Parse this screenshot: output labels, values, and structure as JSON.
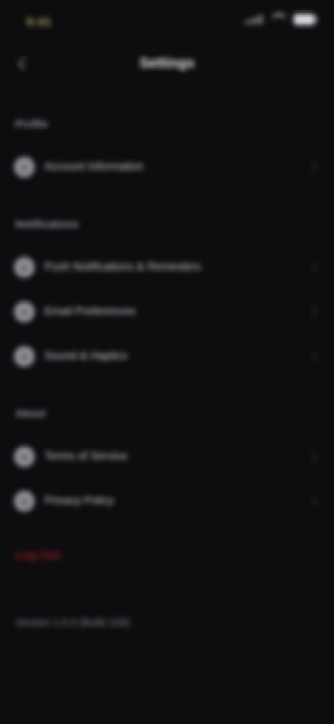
{
  "status": {
    "time": "9:41"
  },
  "header": {
    "title": "Settings"
  },
  "sections": [
    {
      "label": "Profile",
      "items": [
        {
          "label": "Account Information",
          "icon": "user-icon"
        }
      ]
    },
    {
      "label": "Notifications",
      "items": [
        {
          "label": "Push Notifications & Reminders",
          "icon": "bell-icon"
        },
        {
          "label": "Email Preferences",
          "icon": "mail-icon"
        },
        {
          "label": "Sound & Haptics",
          "icon": "sound-icon"
        }
      ]
    },
    {
      "label": "About",
      "items": [
        {
          "label": "Terms of Service",
          "icon": "document-icon"
        },
        {
          "label": "Privacy Policy",
          "icon": "shield-icon"
        }
      ]
    }
  ],
  "danger": {
    "label": "Log Out"
  },
  "footer": {
    "note": "Version 1.0.0 (Build 100)"
  },
  "colors": {
    "background": "#0d0d0f",
    "accent_time": "#b6a26a",
    "danger": "#8a1d27"
  }
}
